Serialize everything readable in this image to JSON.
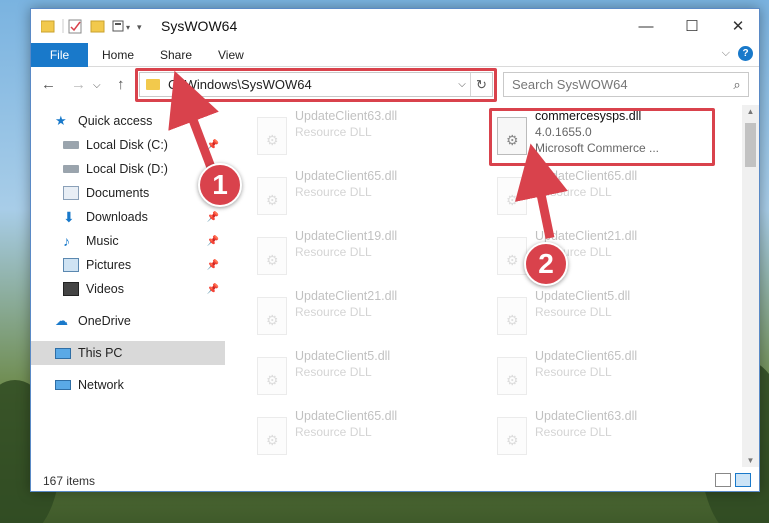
{
  "window": {
    "title": "SysWOW64",
    "controls": {
      "minimize": "—",
      "maximize": "☐",
      "close": "✕"
    }
  },
  "ribbon": {
    "tabs": [
      "File",
      "Home",
      "Share",
      "View"
    ],
    "help": "?"
  },
  "nav": {
    "back": "←",
    "forward": "→",
    "up": "↑",
    "address": "C:\\Windows\\SysWOW64",
    "dropdown": "⌵",
    "refresh": "↻",
    "search_placeholder": "Search SysWOW64",
    "search_icon": "⌕"
  },
  "sidebar": {
    "items": [
      {
        "label": "Quick access",
        "icon": "star-icon",
        "pinned": false,
        "selected": false
      },
      {
        "label": "Local Disk (C:)",
        "icon": "drive-icon",
        "pinned": true,
        "selected": false
      },
      {
        "label": "Local Disk (D:)",
        "icon": "drive-icon",
        "pinned": false,
        "selected": false
      },
      {
        "label": "Documents",
        "icon": "documents-icon",
        "pinned": true,
        "selected": false
      },
      {
        "label": "Downloads",
        "icon": "download-icon",
        "pinned": true,
        "selected": false
      },
      {
        "label": "Music",
        "icon": "music-icon",
        "pinned": true,
        "selected": false
      },
      {
        "label": "Pictures",
        "icon": "pictures-icon",
        "pinned": true,
        "selected": false
      },
      {
        "label": "Videos",
        "icon": "videos-icon",
        "pinned": true,
        "selected": false
      },
      {
        "label": "OneDrive",
        "icon": "cloud-icon",
        "pinned": false,
        "selected": false
      },
      {
        "label": "This PC",
        "icon": "monitor-icon",
        "pinned": false,
        "selected": true
      },
      {
        "label": "Network",
        "icon": "network-icon",
        "pinned": false,
        "selected": false
      }
    ],
    "pin_glyph": "📌"
  },
  "files": {
    "left": [
      {
        "name": "UpdateClient63.dll",
        "sub": "Resource DLL"
      },
      {
        "name": "UpdateClient65.dll",
        "sub": "Resource DLL"
      },
      {
        "name": "UpdateClient19.dll",
        "sub": "Resource DLL"
      },
      {
        "name": "UpdateClient21.dll",
        "sub": "Resource DLL"
      },
      {
        "name": "UpdateClient5.dll",
        "sub": "Resource DLL"
      },
      {
        "name": "UpdateClient65.dll",
        "sub": "Resource DLL"
      }
    ],
    "right": [
      {
        "name": "commercesysps.dll",
        "sub": "4.0.1655.0",
        "sub2": "Microsoft Commerce ...",
        "focus": true
      },
      {
        "name": "UpdateClient65.dll",
        "sub": "Resource DLL"
      },
      {
        "name": "UpdateClient21.dll",
        "sub": "Resource DLL"
      },
      {
        "name": "UpdateClient5.dll",
        "sub": "Resource DLL"
      },
      {
        "name": "UpdateClient65.dll",
        "sub": "Resource DLL"
      },
      {
        "name": "UpdateClient63.dll",
        "sub": "Resource DLL"
      }
    ]
  },
  "status": {
    "count": "167 items"
  },
  "annotations": {
    "marker1": "1",
    "marker2": "2",
    "color": "#d9424c"
  },
  "colors": {
    "accent": "#1979ca",
    "highlight": "#d9424c"
  }
}
